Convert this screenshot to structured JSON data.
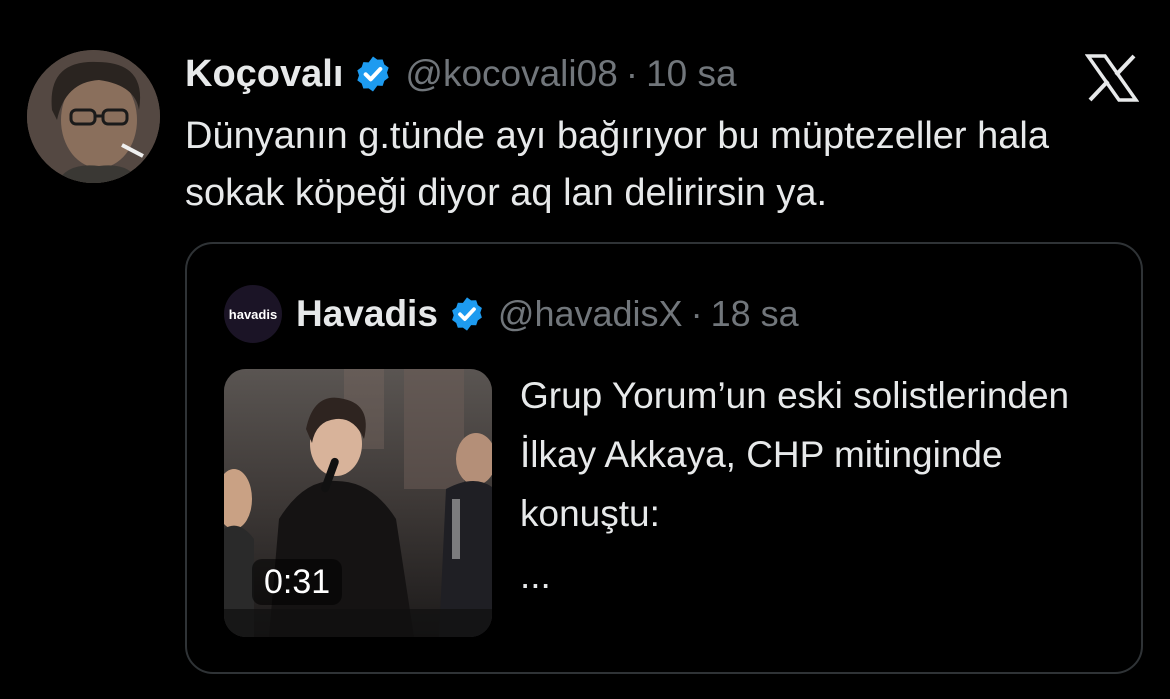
{
  "tweet": {
    "author_name": "Koçovalı",
    "author_handle": "@kocovali08",
    "separator": "·",
    "time": "10 sa",
    "text": "Dünyanın g.tünde ayı bağırıyor bu müptezeller hala sokak köpeği diyor aq lan delirirsin ya.",
    "verified_color": "#1d9bf0"
  },
  "quoted": {
    "author_name": "Havadis",
    "avatar_text": "havadis",
    "author_handle": "@havadisX",
    "separator": "·",
    "time": "18 sa",
    "text": "Grup Yorum’un eski solistlerinden İlkay Akkaya, CHP mitinginde konuştu:",
    "ellipsis": "...",
    "video_duration": "0:31"
  },
  "icons": {
    "platform": "x-logo-icon",
    "verified": "verified-badge-icon"
  },
  "colors": {
    "background": "#000000",
    "text": "#e7e9ea",
    "muted": "#71767b",
    "border": "#2f3336"
  }
}
